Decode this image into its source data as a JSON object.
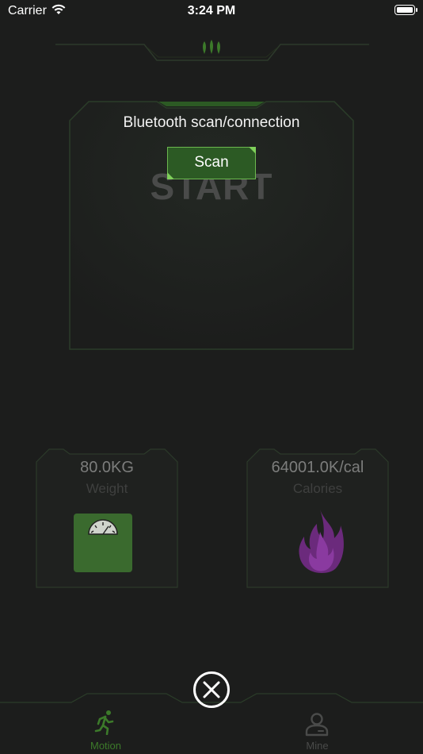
{
  "status_bar": {
    "carrier": "Carrier",
    "time": "3:24 PM"
  },
  "scan_panel": {
    "title": "Bluetooth scan/connection",
    "scan_label": "Scan",
    "start_label": "START"
  },
  "weight_card": {
    "value": "80.0KG",
    "label": "Weight",
    "icon": "scale-icon"
  },
  "calories_card": {
    "value": "64001.0K/cal",
    "label": "Calories",
    "icon": "flame-icon"
  },
  "close_icon": "close-icon",
  "tabs": [
    {
      "label": "Motion",
      "icon": "running-icon",
      "active": true
    },
    {
      "label": "Mine",
      "icon": "person-icon",
      "active": false
    }
  ],
  "colors": {
    "accent": "#6cb84f",
    "active_tab": "#3c7a2a",
    "inactive_tab": "#4a4b4a",
    "flame": "#7a2a8c"
  }
}
